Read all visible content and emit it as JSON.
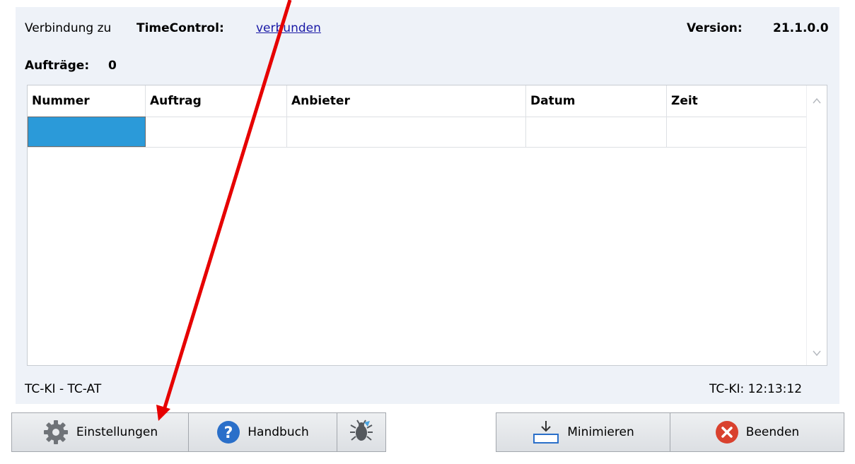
{
  "status": {
    "connection_prefix": "Verbindung zu",
    "connection_target": "TimeControl:",
    "connection_state": "verbunden",
    "version_label": "Version:",
    "version_value": "21.1.0.0",
    "orders_label": "Aufträge:",
    "orders_count": "0"
  },
  "table": {
    "columns": [
      "Nummer",
      "Auftrag",
      "Anbieter",
      "Datum",
      "Zeit"
    ],
    "rows": [
      [
        "",
        "",
        "",
        "",
        ""
      ]
    ]
  },
  "footer": {
    "route": "TC-KI - TC-AT",
    "clock": "TC-KI: 12:13:12"
  },
  "buttons": {
    "settings": "Einstellungen",
    "manual": "Handbuch",
    "minimize": "Minimieren",
    "exit": "Beenden"
  },
  "icons": {
    "settings": "gear-icon",
    "manual": "help-icon",
    "debug": "bug-icon",
    "minimize": "minimize-icon",
    "exit": "close-icon"
  },
  "colors": {
    "selection": "#2b9ad9",
    "link": "#1a1aa6",
    "help_icon": "#2a6fc9",
    "exit_icon": "#d9412e",
    "annotation_arrow": "#e60000"
  }
}
